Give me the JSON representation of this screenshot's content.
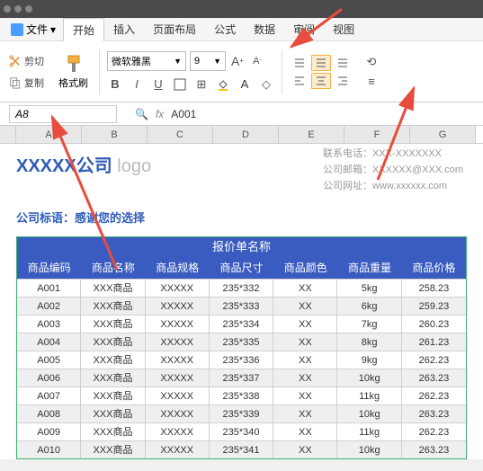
{
  "menu": {
    "file": "文件",
    "tabs": [
      "开始",
      "插入",
      "页面布局",
      "公式",
      "数据",
      "审阅",
      "视图"
    ]
  },
  "ribbon": {
    "cut": "剪切",
    "copy": "复制",
    "paste": "格式刷",
    "font_name": "微软雅黑",
    "font_size": "9",
    "bold": "B",
    "italic": "I",
    "underline": "U"
  },
  "cellref": {
    "name": "A8",
    "fx": "fx",
    "value": "A001"
  },
  "cols": [
    "A",
    "B",
    "C",
    "D",
    "E",
    "F",
    "G"
  ],
  "company": {
    "name": "XXXXX公司",
    "logo_word": "logo",
    "phone_label": "联系电话：",
    "phone": "XXX-XXXXXXX",
    "email_label": "公司邮箱：",
    "email": "XXXXXX@XXX.com",
    "web_label": "公司网址：",
    "web": "www.xxxxxx.com",
    "slogan": "公司标语：感谢您的选择"
  },
  "table": {
    "title": "报价单名称",
    "headers": [
      "商品编码",
      "商品名称",
      "商品规格",
      "商品尺寸",
      "商品颜色",
      "商品重量",
      "商品价格"
    ],
    "rows": [
      [
        "A001",
        "XXX商品",
        "XXXXX",
        "235*332",
        "XX",
        "5kg",
        "258.23"
      ],
      [
        "A002",
        "XXX商品",
        "XXXXX",
        "235*333",
        "XX",
        "6kg",
        "259.23"
      ],
      [
        "A003",
        "XXX商品",
        "XXXXX",
        "235*334",
        "XX",
        "7kg",
        "260.23"
      ],
      [
        "A004",
        "XXX商品",
        "XXXXX",
        "235*335",
        "XX",
        "8kg",
        "261.23"
      ],
      [
        "A005",
        "XXX商品",
        "XXXXX",
        "235*336",
        "XX",
        "9kg",
        "262.23"
      ],
      [
        "A006",
        "XXX商品",
        "XXXXX",
        "235*337",
        "XX",
        "10kg",
        "263.23"
      ],
      [
        "A007",
        "XXX商品",
        "XXXXX",
        "235*338",
        "XX",
        "11kg",
        "262.23"
      ],
      [
        "A008",
        "XXX商品",
        "XXXXX",
        "235*339",
        "XX",
        "10kg",
        "263.23"
      ],
      [
        "A009",
        "XXX商品",
        "XXXXX",
        "235*340",
        "XX",
        "11kg",
        "262.23"
      ],
      [
        "A010",
        "XXX商品",
        "XXXXX",
        "235*341",
        "XX",
        "10kg",
        "263.23"
      ]
    ]
  }
}
